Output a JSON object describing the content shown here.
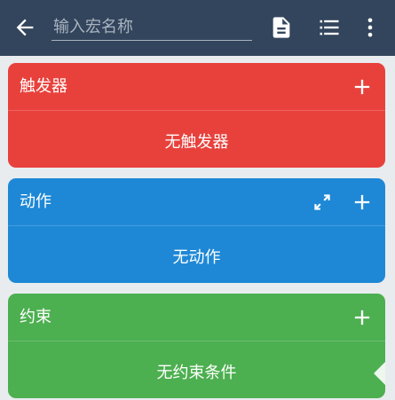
{
  "appbar": {
    "name_placeholder": "输入宏名称",
    "name_value": "",
    "icons": {
      "back": "arrow-left-icon",
      "document": "document-icon",
      "list": "list-icon",
      "more": "more-vert-icon"
    }
  },
  "sections": {
    "trigger": {
      "title": "触发器",
      "empty_text": "无触发器",
      "color": "#e8413c",
      "add_icon": "plus-icon"
    },
    "action": {
      "title": "动作",
      "empty_text": "无动作",
      "color": "#1e88d6",
      "add_icon": "plus-icon",
      "expand_icon": "expand-icon"
    },
    "constraint": {
      "title": "约束",
      "empty_text": "无约束条件",
      "color": "#4caf50",
      "add_icon": "plus-icon"
    }
  },
  "colors": {
    "appbar": "#33455c",
    "background": "#e9ecef"
  }
}
